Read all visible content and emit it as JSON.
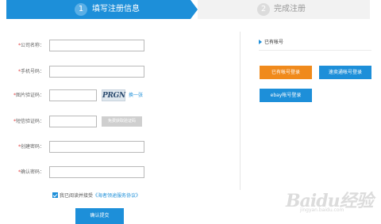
{
  "steps": [
    {
      "number": "1",
      "label": "填写注册信息"
    },
    {
      "number": "2",
      "label": "完成注册"
    }
  ],
  "form": {
    "company_label": "公司名称：",
    "phone_label": "手机号码：",
    "captcha_label": "图片验证码：",
    "captcha_text": "PRGN",
    "refresh_label": "换一张",
    "sms_label": "短信验证码：",
    "sms_button": "免费获取验证码",
    "password_label": "创建密码：",
    "confirm_label": "确认密码：",
    "agree_prefix": "我已阅读并接受",
    "agree_link": "《海者领途服务协议》",
    "submit_label": "确认提交"
  },
  "side": {
    "title": "已有帐号",
    "buttons": [
      {
        "label": "已有帐号登录",
        "color": "#f08a1c"
      },
      {
        "label": "速卖通帐号登录",
        "color": "#1d8fd9"
      },
      {
        "label": "ebay帐号登录",
        "color": "#1d8fd9"
      }
    ]
  },
  "watermark": {
    "main": "Baidu经验",
    "sub": "jingyan.baidu.com"
  },
  "colors": {
    "accent": "#1d8fd9",
    "orange": "#f08a1c",
    "required": "#e03c3c"
  }
}
